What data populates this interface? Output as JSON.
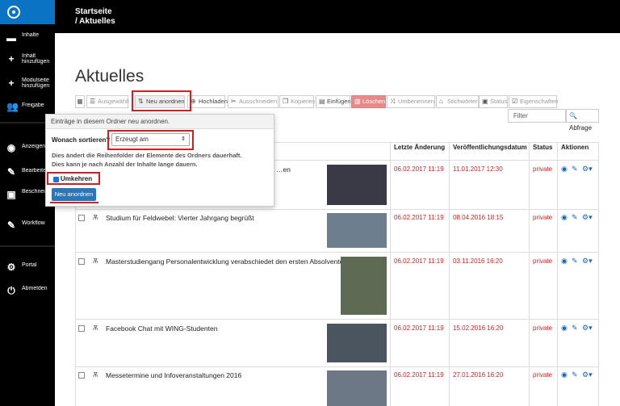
{
  "breadcrumb": {
    "home": "Startseite",
    "current": "/ Aktuelles"
  },
  "sidebar": {
    "items": [
      {
        "icon": "folder-icon",
        "label": "Inhalte"
      },
      {
        "icon": "plus-icon",
        "label": "Inhalt hinzufügen"
      },
      {
        "icon": "plus-icon",
        "label": "Modulseite hinzufügen"
      },
      {
        "icon": "users-icon",
        "label": "Freigabe"
      },
      {
        "icon": "eye-icon",
        "label": "Anzeigen"
      },
      {
        "icon": "pencil-icon",
        "label": "Bearbeiten"
      },
      {
        "icon": "image-icon",
        "label": "Beschneiden"
      },
      {
        "icon": "pencil-icon",
        "label": "Workflow"
      },
      {
        "icon": "gear-icon",
        "label": "Portal"
      },
      {
        "icon": "logout-icon",
        "label": "Abmelden"
      }
    ]
  },
  "page": {
    "title": "Aktuelles"
  },
  "toolbar": {
    "selected": "Ausgewählt",
    "reorder": "Neu anordnen",
    "upload": "Hochladen",
    "cut": "Ausschneiden",
    "copy": "Kopieren",
    "paste": "Einfügen",
    "delete": "Löschen",
    "rename": "Umbenennen",
    "tags": "Stichwörter",
    "status": "Status",
    "properties": "Eigenschaften"
  },
  "filter": {
    "placeholder": "Filter",
    "button": "Abfrage"
  },
  "table": {
    "headers": {
      "modified": "Letzte Änderung",
      "published": "Veröffentlichungsdatum",
      "status": "Status",
      "actions": "Aktionen"
    },
    "rows": [
      {
        "title": "…en",
        "modified": "06.02.2017 11:19",
        "published": "11.01.2017 12:30",
        "status": "private"
      },
      {
        "title": "Studium für Feldwebel: Vierter Jahrgang begrüßt",
        "modified": "06.02.2017 11:19",
        "published": "08.04.2016 18:15",
        "status": "private"
      },
      {
        "title": "Masterstudiengang Personalentwicklung verabschiedet den ersten Absolventen",
        "modified": "06.02.2017 11:19",
        "published": "03.11.2016 16:20",
        "status": "private"
      },
      {
        "title": "Facebook Chat mit WING-Studenten",
        "modified": "06.02.2017 11:19",
        "published": "15.02.2016 16:20",
        "status": "private"
      },
      {
        "title": "Messetermine und Infoveranstaltungen 2016",
        "modified": "06.02.2017 11:19",
        "published": "27.01.2016 16:20",
        "status": "private"
      }
    ]
  },
  "popover": {
    "header": "Einträge in diesem Ordner neu anordnen.",
    "sort_label": "Wonach sortieren?",
    "sort_value": "Erzeugt am",
    "desc1": "Dies ändert die Reihenfolder der Elemente des Ordners dauerhaft.",
    "desc2": "Dies kann je nach Anzahl der Inhalte lange dauern.",
    "reverse_label": "Umkehren",
    "submit": "Neu anordnen"
  }
}
